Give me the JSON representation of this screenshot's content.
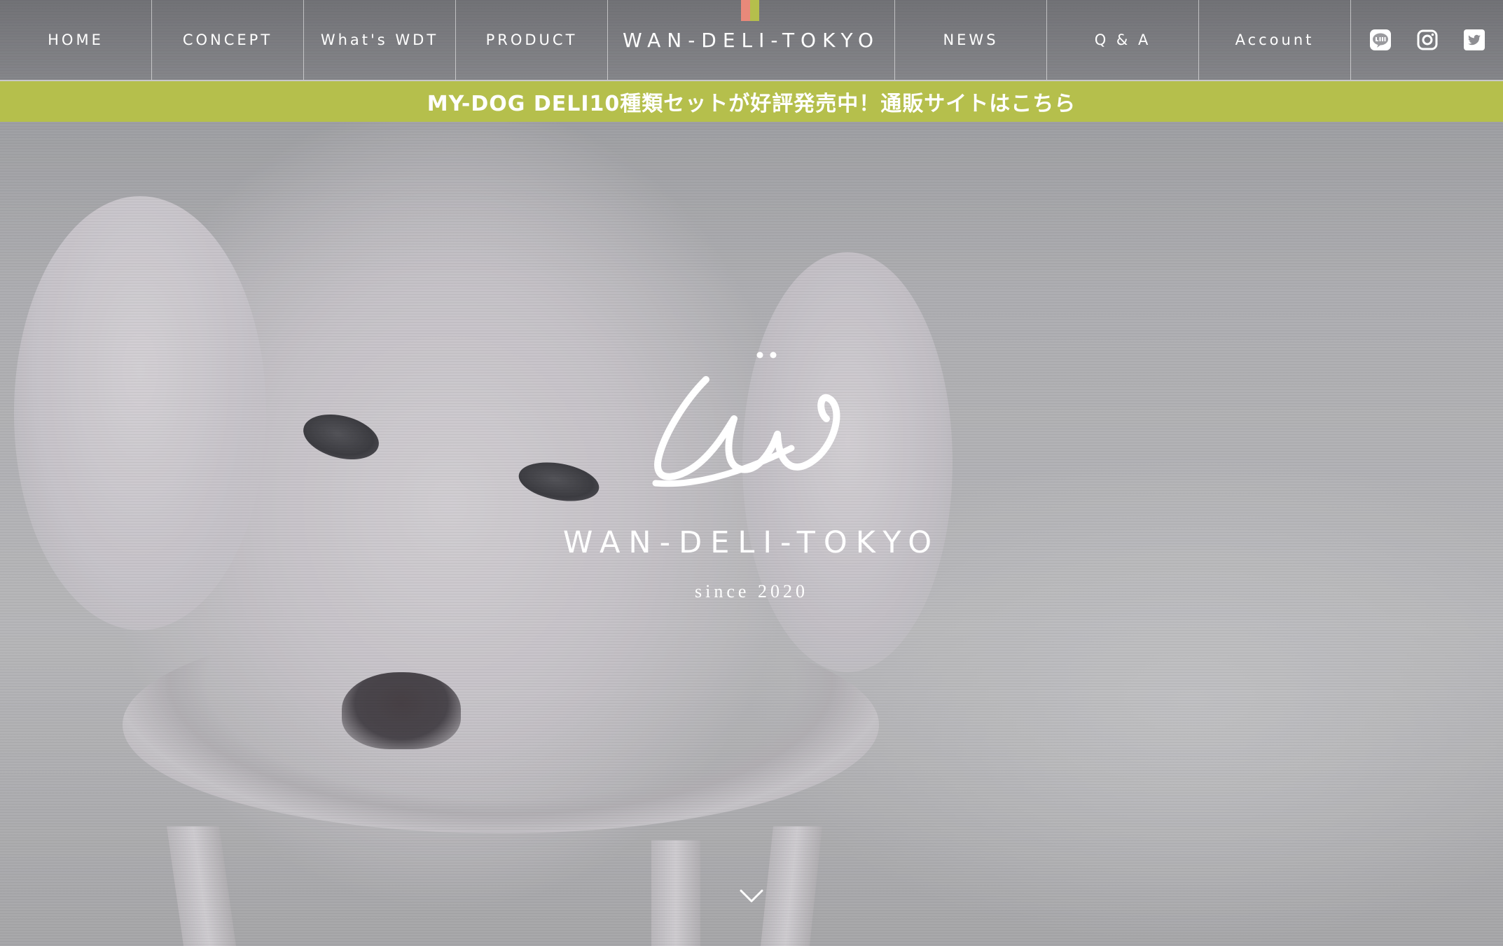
{
  "nav": {
    "items": [
      {
        "label": "HOME"
      },
      {
        "label": "CONCEPT"
      },
      {
        "label": "What's WDT"
      },
      {
        "label": "PRODUCT"
      }
    ],
    "logo_text": "WAN-DELI-TOKYO",
    "items_right": [
      {
        "label": "NEWS"
      },
      {
        "label": "Q & A"
      },
      {
        "label": "Account"
      }
    ],
    "social": [
      {
        "icon": "line-icon"
      },
      {
        "icon": "instagram-icon"
      },
      {
        "icon": "twitter-icon"
      }
    ]
  },
  "banner": {
    "text": "MY-DOG DELI10種類セットが好評発売中！通販サイトはこちら",
    "color": "#b5bf4c"
  },
  "hero": {
    "brand_name": "WAN-DELI-TOKYO",
    "since": "since 2020",
    "scroll_icon": "chevron-down-icon"
  },
  "colors": {
    "accent_chip": [
      "#e9897a",
      "#b5bf4c"
    ]
  }
}
